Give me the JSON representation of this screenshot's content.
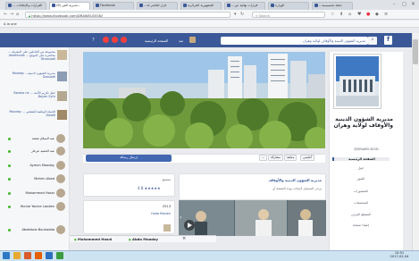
{
  "browser": {
    "tabs": [
      {
        "label": "... القرارات والإعلانات"
      },
      {
        "label": "(6) مديرية الش..."
      },
      {
        "label": "Facebook"
      },
      {
        "label": "...قرار العاشر لة"
      },
      {
        "label": "الجمهورية الجزائرية"
      },
      {
        "label": "...قرارات نهائية عن"
      },
      {
        "label": "الوزارة"
      },
      {
        "label": "...حملة تحسيسية"
      }
    ],
    "url": "https://www.facebook.com/DRAWELSEGN/",
    "search_placeholder": "Search",
    "bookmark": "A la une"
  },
  "fb_header": {
    "search_text": "مديرية الشؤون الدينية والأوقاف لولاية وهران",
    "home_label": "الصفحة الرئيسية",
    "profile_label": "عبد",
    "colors": {
      "bar": "#3b5998",
      "like_button": "#4267b2"
    }
  },
  "left_posts": [
    {
      "text": "مجموعة من الحاملين على المعرفة ... محاضرة على الموقع ... Abdeerzak Dhaouadi"
    },
    {
      "text": "مديرية الشؤون الدينية... Mooday Daouadi"
    },
    {
      "text": "حفل تكريم الأئمة ... Baraka ne Bayan Syhr"
    },
    {
      "text": "الحملة الوطنية للتشجير ... Mooday Dwadi"
    }
  ],
  "contacts": [
    {
      "name": "عبد السلام محمد"
    },
    {
      "name": "عبد الحميد عرعار"
    },
    {
      "name": "Aymen Mooday"
    },
    {
      "name": "Mehrin Abed"
    },
    {
      "name": "Mohammed Hosni"
    },
    {
      "name": "Yacine Yacine Landen"
    },
    {
      "name": "Abdelaziz Bouhadda"
    }
  ],
  "page": {
    "name": "مديرية الشؤون الدينية والأوقاف لولاية وهران",
    "handle": "@DRAWELSEGN",
    "menu": [
      {
        "label": "الصفحة الرئيسية"
      },
      {
        "label": "حول"
      },
      {
        "label": "الصور"
      },
      {
        "label": "المنشورات"
      },
      {
        "label": "المجتمعات"
      },
      {
        "label": "المقطع المرئي"
      },
      {
        "label": "إنشاء صفحة"
      }
    ]
  },
  "actions": {
    "like": "أعجبني",
    "follow": "متابعة",
    "share": "مشاركة",
    "more": "...",
    "message": "إرسال رسالة"
  },
  "feed": {
    "info_label": "مجتمع",
    "rating": "4.8 ★★★★★",
    "post_title": "مديرية الشؤون الدينية والأوقاف",
    "post_subtitle": "يرجى التسجيل لإعجاب بهذه الصفحة أو",
    "count": "2513",
    "by": "Hoda Mosleh",
    "chat_names": [
      "Muhammed Hosni",
      "Abdo Mooday"
    ]
  },
  "taskbar": {
    "time": "10:51",
    "date": "2017-02-04"
  }
}
